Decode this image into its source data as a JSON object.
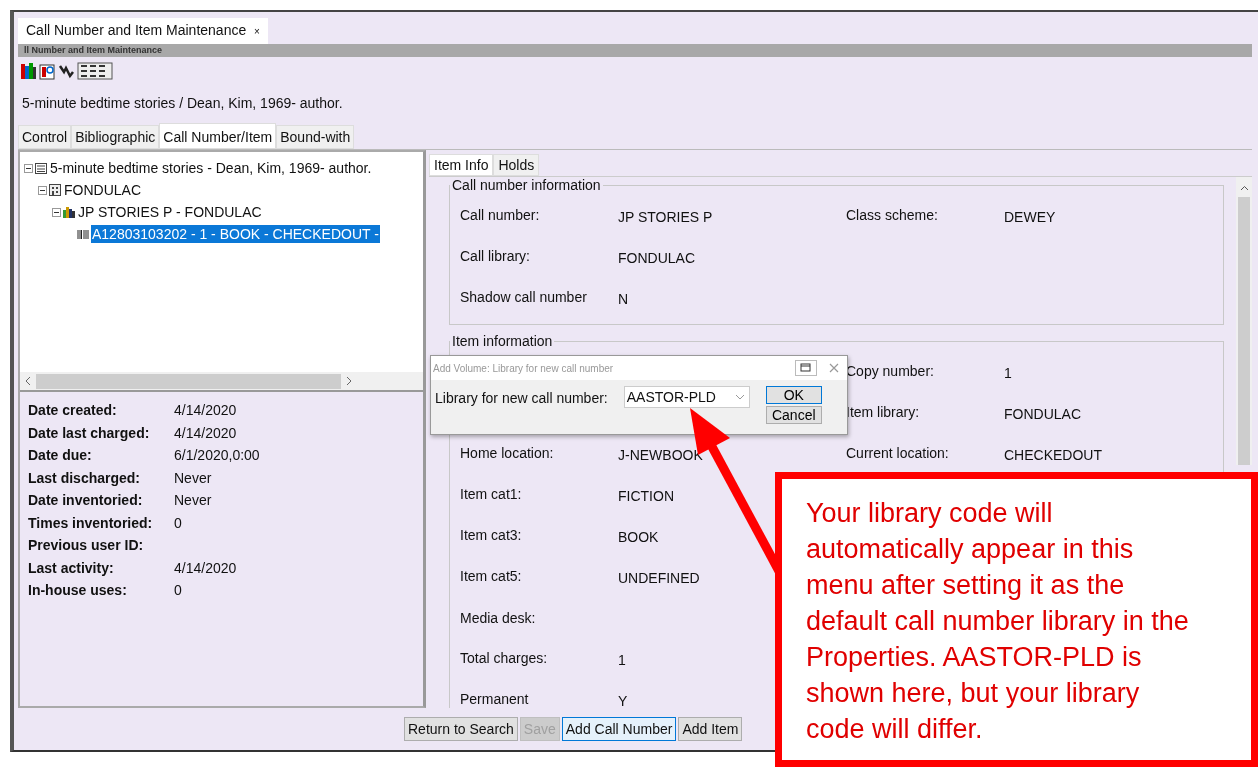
{
  "document_tab": {
    "label": "Call Number and Item Maintenance",
    "close": "×"
  },
  "frame_title": "ll Number and Item Maintenance",
  "record_title": "5-minute bedtime stories / Dean, Kim, 1969- author.",
  "tabs": [
    {
      "label": "Control",
      "selected": false
    },
    {
      "label": "Bibliographic",
      "selected": false
    },
    {
      "label": "Call Number/Item",
      "selected": true
    },
    {
      "label": "Bound-with",
      "selected": false
    }
  ],
  "tree": [
    {
      "kind": "title",
      "label": "5-minute bedtime stories - Dean, Kim, 1969- author.",
      "expanded": true,
      "selected": false,
      "children": [
        {
          "kind": "library",
          "label": "FONDULAC",
          "expanded": true,
          "selected": false,
          "children": [
            {
              "kind": "callnumber",
              "label": "JP STORIES P - FONDULAC",
              "expanded": true,
              "selected": false,
              "children": [
                {
                  "kind": "item",
                  "label": "A12803103202 - 1 - BOOK - CHECKEDOUT -",
                  "selected": true
                }
              ]
            }
          ]
        }
      ]
    }
  ],
  "item_summary": [
    {
      "label": "Date created:",
      "value": "4/14/2020"
    },
    {
      "label": "Date last charged:",
      "value": "4/14/2020"
    },
    {
      "label": "Date due:",
      "value": "6/1/2020,0:00"
    },
    {
      "label": "Last discharged:",
      "value": "Never"
    },
    {
      "label": "Date inventoried:",
      "value": "Never"
    },
    {
      "label": "Times inventoried:",
      "value": "0"
    },
    {
      "label": "Previous user ID:"
    },
    {
      "label": "Last activity:",
      "value": "4/14/2020"
    },
    {
      "label": "In-house uses:",
      "value": "0"
    }
  ],
  "detail_tabs": [
    {
      "label": "Item Info",
      "selected": true
    },
    {
      "label": "Holds",
      "selected": false
    }
  ],
  "call_number_information": {
    "title": "Call number information",
    "rows": [
      {
        "left": {
          "label": "Call number:",
          "value": "JP STORIES P"
        },
        "right": {
          "label": "Class scheme:",
          "value": "DEWEY"
        }
      },
      {
        "left": {
          "label": "Call library:",
          "value": "FONDULAC"
        }
      },
      {
        "left": {
          "label": "Shadow call number",
          "value": "N"
        }
      }
    ]
  },
  "item_information": {
    "title": "Item information",
    "rows": [
      {
        "right": {
          "label": "Copy number:",
          "value": "1"
        }
      },
      {
        "right": {
          "label": "Item library:",
          "value": "FONDULAC"
        }
      },
      {
        "left": {
          "label": "Home location:",
          "value": "J-NEWBOOK"
        },
        "right": {
          "label": "Current location:",
          "value": "CHECKEDOUT"
        }
      },
      {
        "left": {
          "label": "Item cat1:",
          "value": "FICTION"
        }
      },
      {
        "left": {
          "label": "Item cat3:",
          "value": "BOOK"
        }
      },
      {
        "left": {
          "label": "Item cat5:",
          "value": "UNDEFINED"
        }
      },
      {
        "left": {
          "label": "Media desk:"
        }
      },
      {
        "left": {
          "label": "Total charges:",
          "value": "1"
        }
      },
      {
        "left": {
          "label": "Permanent",
          "value": "Y"
        }
      }
    ]
  },
  "buttons": [
    {
      "label": "Return to Search",
      "disabled": false,
      "focused": false
    },
    {
      "label": "Save",
      "disabled": true,
      "focused": false
    },
    {
      "label": "Add Call Number",
      "disabled": false,
      "focused": true
    },
    {
      "label": "Add Item",
      "disabled": false,
      "focused": false
    }
  ],
  "dialog": {
    "title": "Add Volume: Library for new call number",
    "field_label": "Library for new call number:",
    "value": "AASTOR-PLD",
    "buttons": [
      {
        "label": "OK",
        "default": true
      },
      {
        "label": "Cancel",
        "default": false
      }
    ]
  },
  "callout": {
    "text": "Your library code will automatically appear in this menu after setting it as the default call number library in the Properties. AASTOR-PLD is shown here, but your library code will differ."
  }
}
